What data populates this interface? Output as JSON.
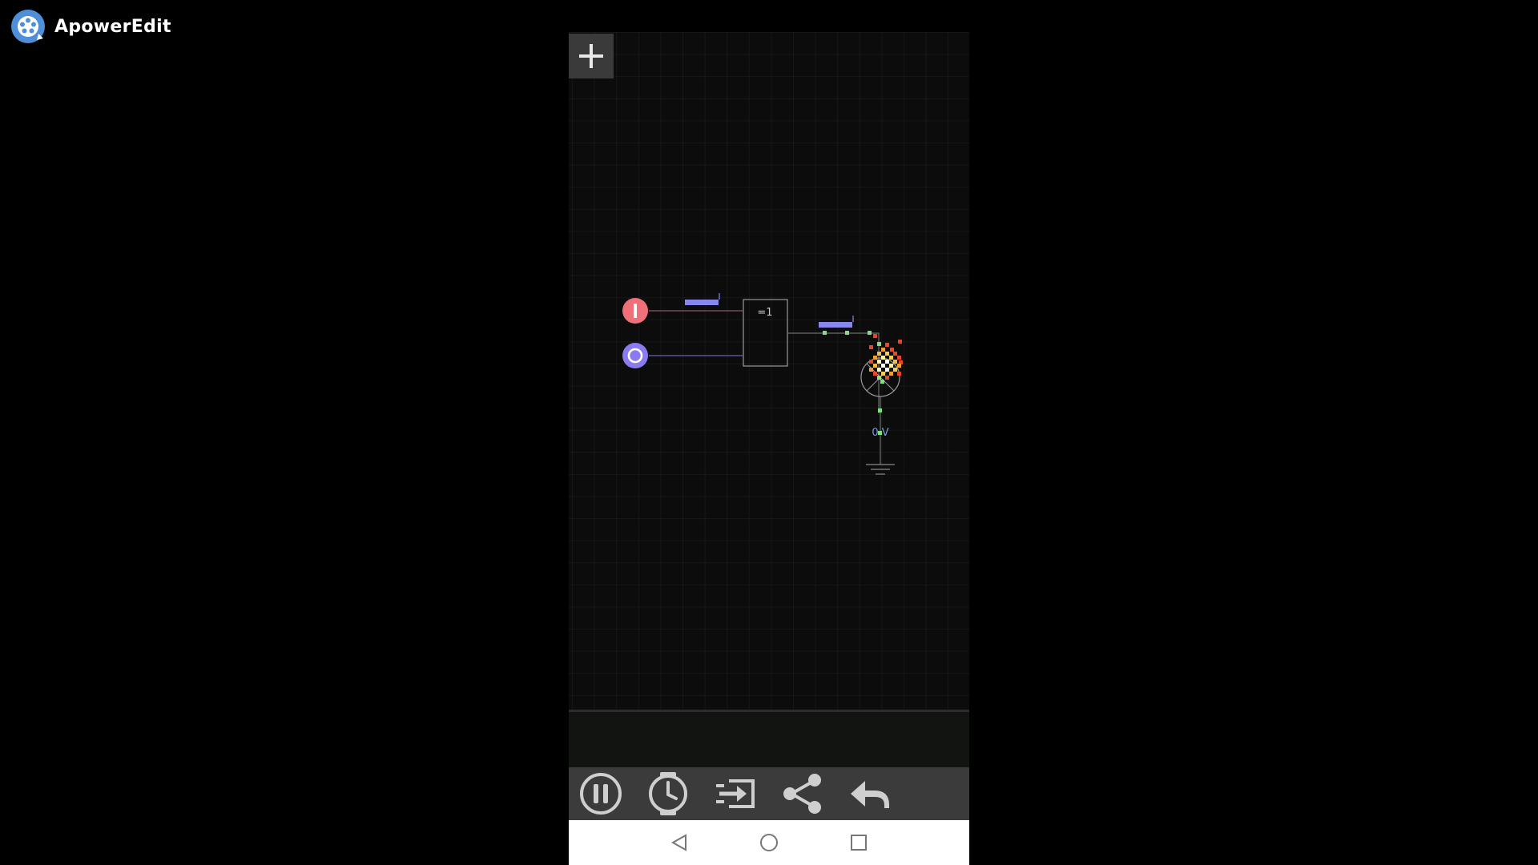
{
  "watermark": {
    "app_name": "ApowerEdit"
  },
  "circuit": {
    "gate_label": "=1",
    "output_voltage": "0 V"
  },
  "toolbar": {
    "buttons": [
      "pause-icon",
      "clock-icon",
      "import-icon",
      "share-icon",
      "undo-icon"
    ]
  },
  "navbar": {
    "buttons": [
      "back-icon",
      "home-icon",
      "recents-icon"
    ]
  },
  "colors": {
    "input_high": "#f0707a",
    "input_low": "#8a7cf0",
    "signal_bar": "#8a86f0",
    "toolbar_bg": "#3b3b3b",
    "toolbar_icon": "#cfcfcf"
  }
}
